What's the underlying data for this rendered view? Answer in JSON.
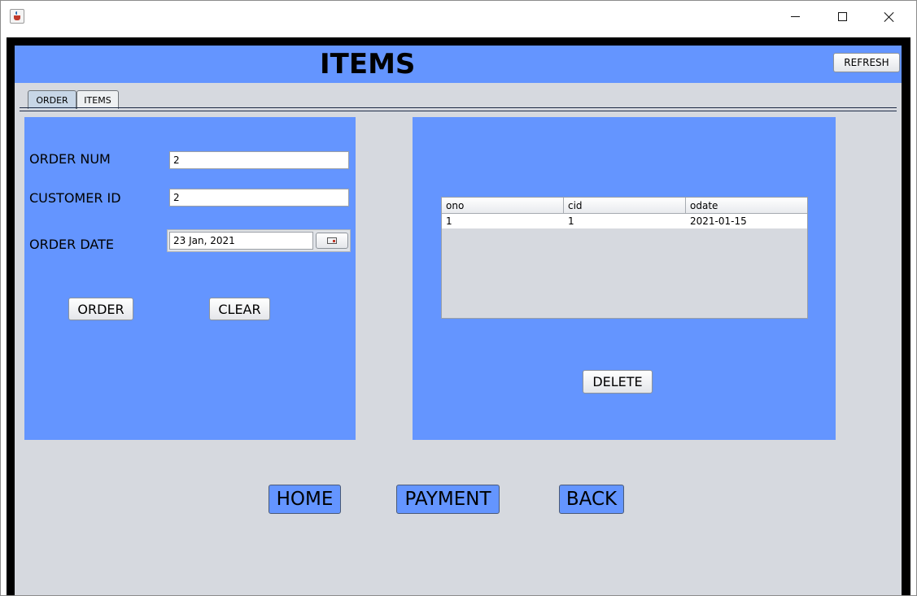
{
  "header": {
    "title": "ITEMS",
    "refresh_label": "REFRESH"
  },
  "tabs": [
    {
      "label": "ORDER",
      "active": true
    },
    {
      "label": "ITEMS",
      "active": false
    }
  ],
  "order_form": {
    "order_num_label": "ORDER NUM",
    "order_num_value": "2",
    "customer_id_label": "CUSTOMER ID",
    "customer_id_value": "2",
    "order_date_label": "ORDER DATE",
    "order_date_value": "23 Jan, 2021",
    "order_button": "ORDER",
    "clear_button": "CLEAR"
  },
  "orders_table": {
    "columns": [
      "ono",
      "cid",
      "odate"
    ],
    "rows": [
      [
        "1",
        "1",
        "2021-01-15"
      ]
    ],
    "delete_button": "DELETE"
  },
  "nav": {
    "home": "HOME",
    "payment": "PAYMENT",
    "back": "BACK"
  },
  "colors": {
    "panel": "#6495ff",
    "background": "#d6d9df",
    "frame": "#000000"
  },
  "icons": {
    "app": "java-cup-icon",
    "calendar": "calendar-icon"
  }
}
